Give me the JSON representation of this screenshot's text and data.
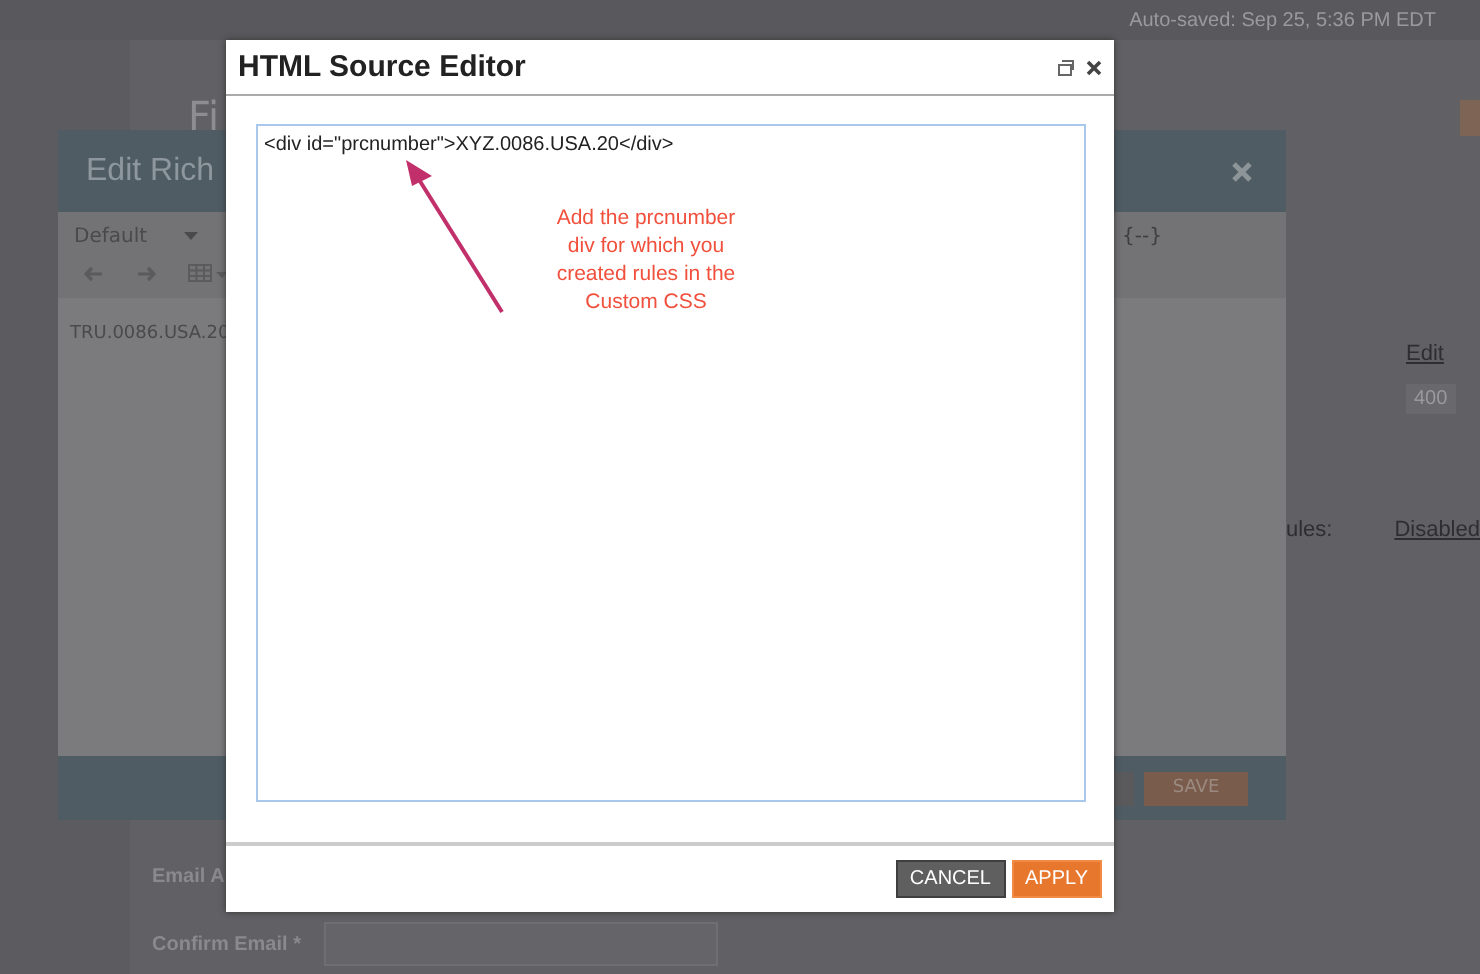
{
  "background": {
    "status": "Auto-saved: Sep 25, 5:36 PM EDT",
    "page_title": "Fi",
    "rich_editor": {
      "title": "Edit Rich",
      "style_select": "Default",
      "token": "{--}",
      "content": "TRU.0086.USA.20",
      "save_button": "SAVE"
    },
    "settings": [
      {
        "value": "Edit",
        "kind": "link"
      },
      {
        "value": "400",
        "kind": "input"
      },
      {
        "label": "ules:",
        "value": "Disabled",
        "kind": "link"
      }
    ],
    "form": [
      {
        "label": "Email A",
        "kind": "text"
      },
      {
        "label": "Confirm Email *",
        "kind": "input"
      }
    ]
  },
  "dialog": {
    "title": "HTML Source Editor",
    "source": {
      "value": "<div id=\"prcnumber\">XYZ.0086.USA.20</div>"
    },
    "annotation": {
      "lines": [
        "Add the prcnumber",
        "div for which you",
        "created rules in the",
        "Custom CSS"
      ],
      "color": "#f0503c"
    },
    "buttons": [
      {
        "label": "CANCEL",
        "kind": "secondary"
      },
      {
        "label": "APPLY",
        "kind": "primary"
      }
    ]
  }
}
